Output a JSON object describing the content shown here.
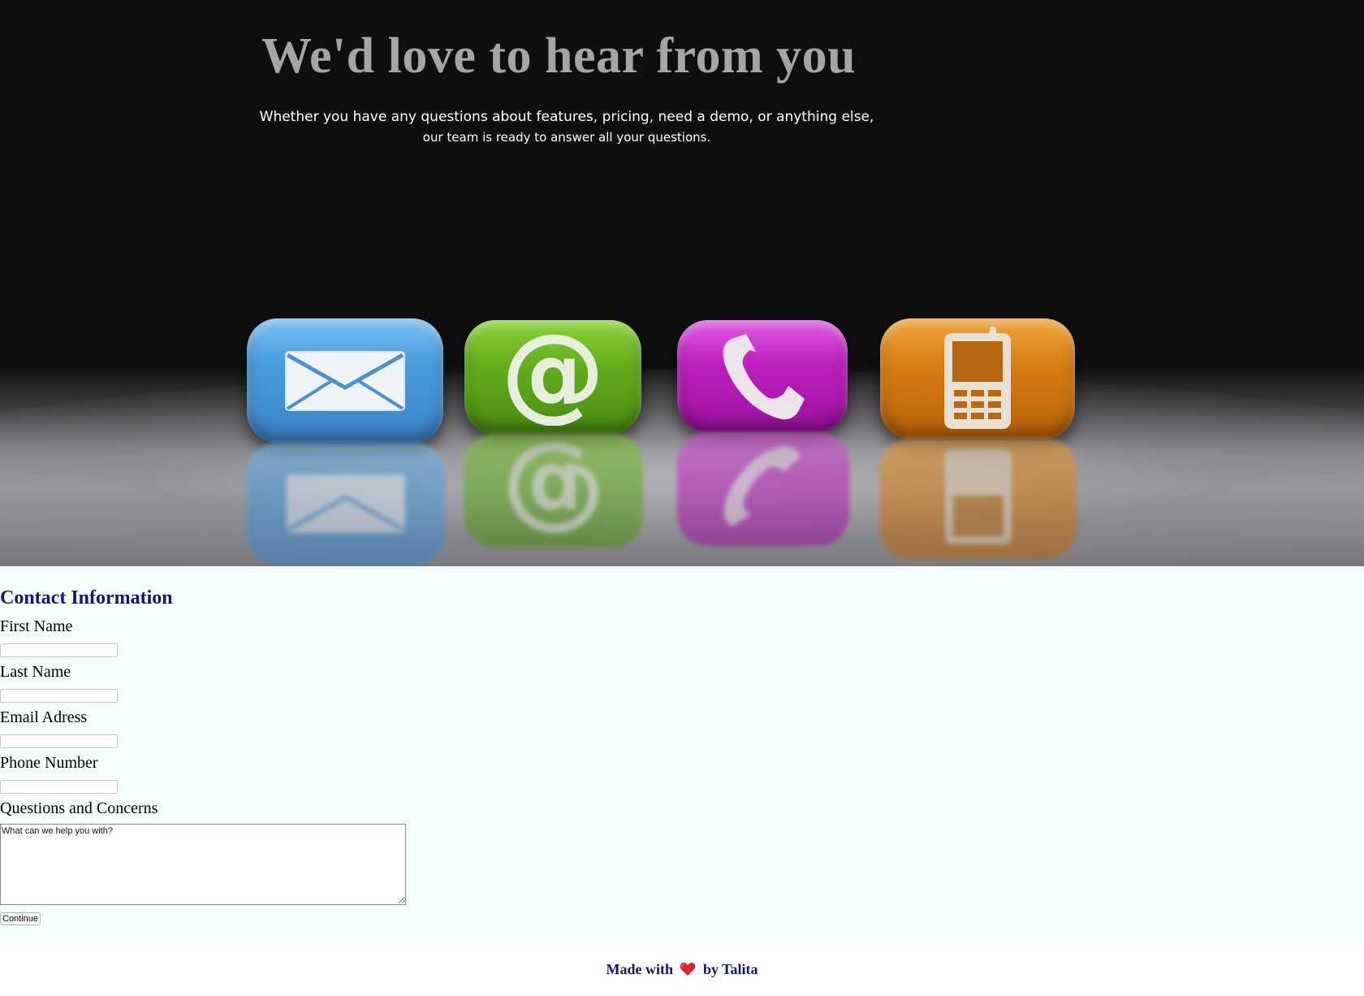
{
  "hero": {
    "title": "We'd love to hear from you",
    "subtitle_line1": "Whether you have any questions about features, pricing, need a demo, or anything else,",
    "subtitle_line2": "our team is ready to answer all your questions.",
    "image_icons": [
      "envelope-icon",
      "at-sign-icon",
      "phone-icon",
      "mobile-phone-icon"
    ]
  },
  "form": {
    "title": "Contact Information",
    "first_name_label": "First Name",
    "first_name_value": "",
    "last_name_label": "Last Name",
    "last_name_value": "",
    "email_label": "Email Adress",
    "email_value": "",
    "phone_label": "Phone Number",
    "phone_value": "",
    "questions_label": "Questions and Concerns",
    "questions_placeholder": "What can we help you with?",
    "submit_label": "Continue"
  },
  "footer": {
    "text_before": "Made with",
    "text_after": "by Talita",
    "heart_icon": "heart-icon"
  },
  "colors": {
    "heading_navy": "#15156b",
    "form_background": "#f5fffe",
    "hero_title": "#a7a4a6"
  }
}
